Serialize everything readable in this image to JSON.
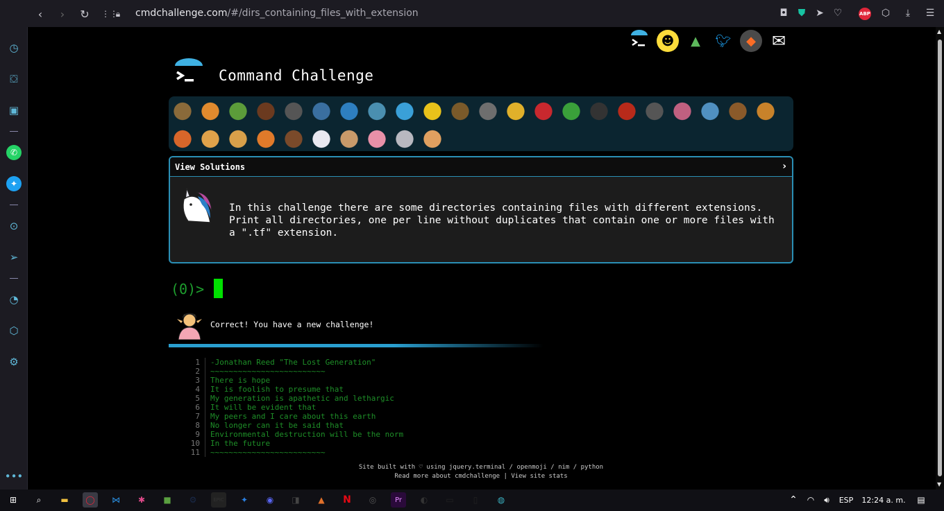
{
  "browser": {
    "url_domain": "cmdchallenge.com",
    "url_path": "/#/dirs_containing_files_with_extension",
    "nav": {
      "back": "‹",
      "forward": "›",
      "reload": "↻"
    },
    "right_icons": [
      "camera-icon",
      "shield-icon",
      "send-icon",
      "heart-icon",
      "adblock-icon",
      "cube-icon",
      "download-icon",
      "menu-icon"
    ],
    "adblock_label": "ABP"
  },
  "sidebar_icons": [
    "speed-dial-icon",
    "bag-icon",
    "twitch-icon",
    "whatsapp-icon",
    "twitter-icon",
    "player-icon",
    "send-icon",
    "history-icon",
    "cube-icon",
    "settings-icon",
    "more-icon"
  ],
  "site": {
    "title": "Command Challenge",
    "social": [
      "cmd-logo-icon",
      "shush-face-icon",
      "tree-icon",
      "twitter-icon",
      "gitlab-icon",
      "mail-icon"
    ],
    "badges_row1": [
      "snail",
      "butterfly",
      "caterpillar",
      "ant",
      "shell",
      "whale",
      "dolphin",
      "dolphin",
      "fish",
      "tropical-fish",
      "hedgehog",
      "wolf",
      "bee",
      "ladybug",
      "lizard",
      "spider",
      "scorpion",
      "fly",
      "worm",
      "microbe",
      "monkey",
      "dog"
    ],
    "badges_row2": [
      "fox",
      "cat",
      "lion",
      "tiger",
      "horse",
      "unicorn",
      "cow",
      "pig",
      "mouse",
      "hamster"
    ],
    "panel": {
      "header": "View Solutions",
      "chevron": "›",
      "description": "In this challenge there are some directories containing files with different extensions. Print all directories, one per line without duplicates that contain one or more files with a \".tf\" extension."
    },
    "prompt": "(0)>",
    "correct": "Correct! You have a new challenge!",
    "poem": [
      {
        "n": "1",
        "t": "-Jonathan Reed \"The Lost Generation\""
      },
      {
        "n": "2",
        "t": "~~~~~~~~~~~~~~~~~~~~~~~~~"
      },
      {
        "n": "3",
        "t": "There is hope"
      },
      {
        "n": "4",
        "t": "It is foolish to presume that"
      },
      {
        "n": "5",
        "t": "My generation is apathetic and lethargic"
      },
      {
        "n": "6",
        "t": "It will be evident that"
      },
      {
        "n": "7",
        "t": "My peers and I care about this earth"
      },
      {
        "n": "8",
        "t": "No longer can it be said that"
      },
      {
        "n": "9",
        "t": "Environmental destruction will be the norm"
      },
      {
        "n": "10",
        "t": "In the future"
      },
      {
        "n": "11",
        "t": "~~~~~~~~~~~~~~~~~~~~~~~~~"
      }
    ],
    "footer_line1": "Site built with ♡ using jquery.terminal / openmoji / nim / python",
    "footer_line2": "Read more about cmdchallenge | View site stats"
  },
  "taskbar": {
    "apps": [
      "start-icon",
      "search-icon",
      "explorer-icon",
      "opera-icon",
      "vscode-icon",
      "slack-icon",
      "minecraft-icon",
      "steam-icon",
      "epic-icon",
      "app-icon",
      "discord-icon",
      "app-icon",
      "app-icon",
      "netflix-icon",
      "app-icon",
      "premiere-icon",
      "github-icon",
      "cmd-icon",
      "terminal-icon",
      "paint-icon"
    ],
    "epic_label": "EPIC",
    "premiere_label": "Pr",
    "lang": "ESP",
    "time": "12:24 a. m."
  }
}
